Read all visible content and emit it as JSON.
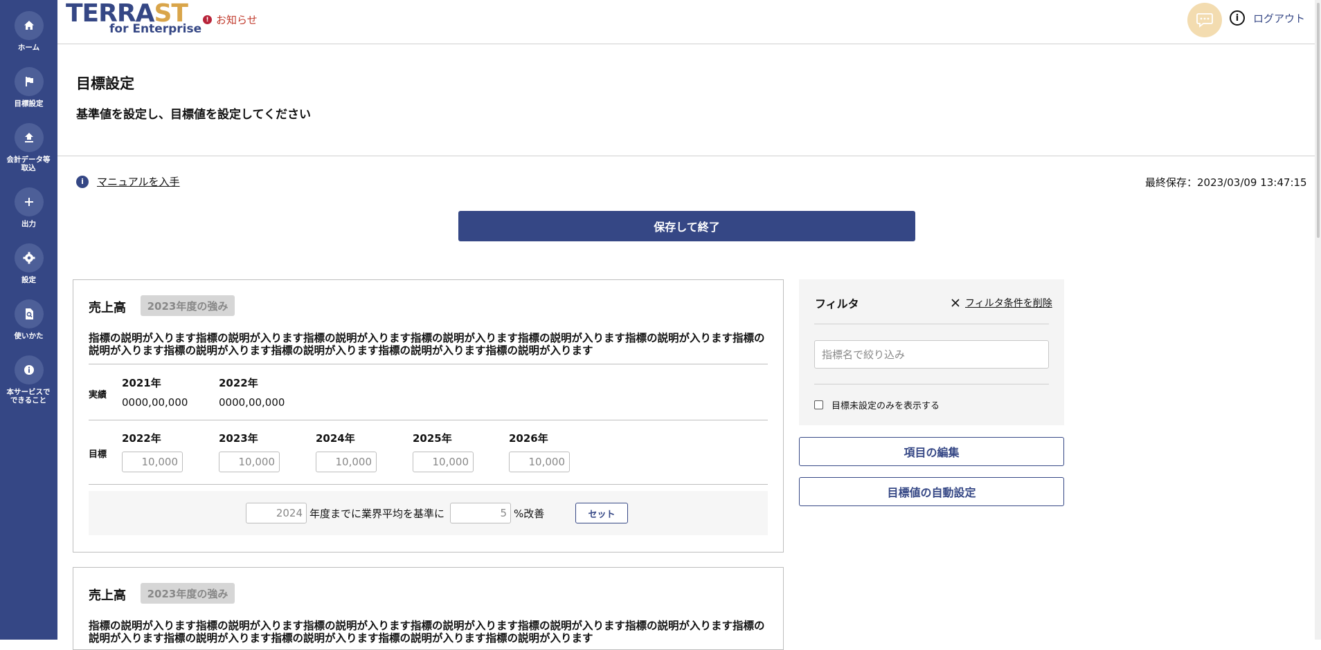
{
  "brand": {
    "logo_main_a": "TERRA",
    "logo_main_b": "ST",
    "logo_sub": "for Enterprise"
  },
  "header": {
    "notice": "お知らせ",
    "logout": "ログアウト"
  },
  "sidebar": {
    "items": [
      {
        "label": "ホーム",
        "icon": "home-icon"
      },
      {
        "label": "目標設定",
        "icon": "flag-icon"
      },
      {
        "label": "会計データ等取込",
        "icon": "upload-icon"
      },
      {
        "label": "出力",
        "icon": "plus-icon"
      },
      {
        "label": "設定",
        "icon": "gear-icon"
      },
      {
        "label": "使いかた",
        "icon": "search-doc-icon"
      },
      {
        "label": "本サービスでできること",
        "icon": "info-icon"
      }
    ]
  },
  "page": {
    "title": "目標設定",
    "subtitle": "基準値を設定し、目標値を設定してください",
    "manual_link": "マニュアルを入手",
    "last_saved": "最終保存：2023/03/09 13:47:15",
    "save_button": "保存して終了"
  },
  "cards": [
    {
      "title": "売上高",
      "badge": "2023年度の強み",
      "description": "指標の説明が入ります指標の説明が入ります指標の説明が入ります指標の説明が入ります指標の説明が入ります指標の説明が入ります指標の説明が入ります指標の説明が入ります指標の説明が入ります指標の説明が入ります指標の説明が入ります",
      "actual_label": "実績",
      "actual": [
        {
          "year": "2021年",
          "value": "0000,00,000"
        },
        {
          "year": "2022年",
          "value": "0000,00,000"
        }
      ],
      "target_label": "目標",
      "targets": [
        {
          "year": "2022年",
          "value": "10,000"
        },
        {
          "year": "2023年",
          "value": "10,000"
        },
        {
          "year": "2024年",
          "value": "10,000"
        },
        {
          "year": "2025年",
          "value": "10,000"
        },
        {
          "year": "2026年",
          "value": "10,000"
        }
      ],
      "set_row": {
        "year_value": "2024",
        "text1": "年度までに業界平均を基準に",
        "percent_value": "5",
        "text2": "%改善",
        "button": "セット"
      }
    },
    {
      "title": "売上高",
      "badge": "2023年度の強み",
      "description": "指標の説明が入ります指標の説明が入ります指標の説明が入ります指標の説明が入ります指標の説明が入ります指標の説明が入ります指標の説明が入ります指標の説明が入ります指標の説明が入ります指標の説明が入ります指標の説明が入ります"
    }
  ],
  "filter": {
    "title": "フィルタ",
    "clear": "フィルタ条件を削除",
    "search_placeholder": "指標名で絞り込み",
    "checkbox_label": "目標未設定のみを表示する"
  },
  "actions": {
    "edit_items": "項目の編集",
    "auto_set": "目標値の自動設定"
  }
}
